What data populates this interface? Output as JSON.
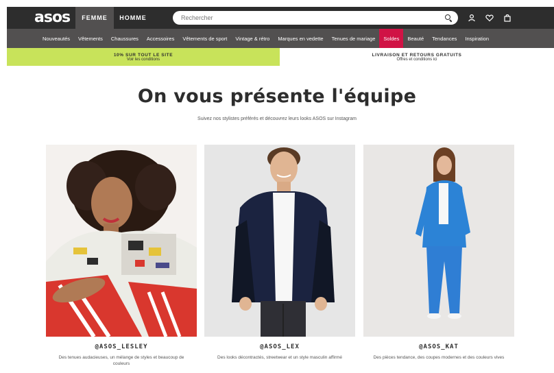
{
  "header": {
    "logo": "asos",
    "tabs": [
      {
        "label": "FEMME",
        "active": true
      },
      {
        "label": "HOMME",
        "active": false
      }
    ],
    "search_placeholder": "Rechercher",
    "icons": [
      "search-icon",
      "account-icon",
      "wishlist-icon",
      "bag-icon"
    ]
  },
  "nav": {
    "items": [
      "Nouveautés",
      "Vêtements",
      "Chaussures",
      "Accessoires",
      "Vêtements de sport",
      "Vintage & rétro",
      "Marques en vedette",
      "Tenues de mariage",
      "Soldes",
      "Beauté",
      "Tendances",
      "Inspiration"
    ],
    "sale_index": 8
  },
  "promo": {
    "left_title": "10% SUR TOUT LE SITE",
    "left_sub": "Voir les conditions",
    "right_title": "LIVRAISON ET RETOURS GRATUITS",
    "right_sub": "Offres et conditions ici"
  },
  "main": {
    "title": "On vous présente l'équipe",
    "subtitle": "Suivez nos stylistes préférés et découvrez leurs looks ASOS sur Instagram"
  },
  "cards": [
    {
      "name": "@ASOS_LESLEY",
      "desc": "Des tenues audacieuses, un mélange de styles et beaucoup de couleurs"
    },
    {
      "name": "@ASOS_LEX",
      "desc": "Des looks décontractés, streetwear et un style masculin affirmé"
    },
    {
      "name": "@ASOS_KAT",
      "desc": "Des pièces tendance, des coupes modernes et des couleurs vives"
    }
  ],
  "colors": {
    "topbar": "#2d2d2d",
    "navbar": "#525050",
    "sale": "#d01345",
    "promo": "#c8e35a"
  }
}
